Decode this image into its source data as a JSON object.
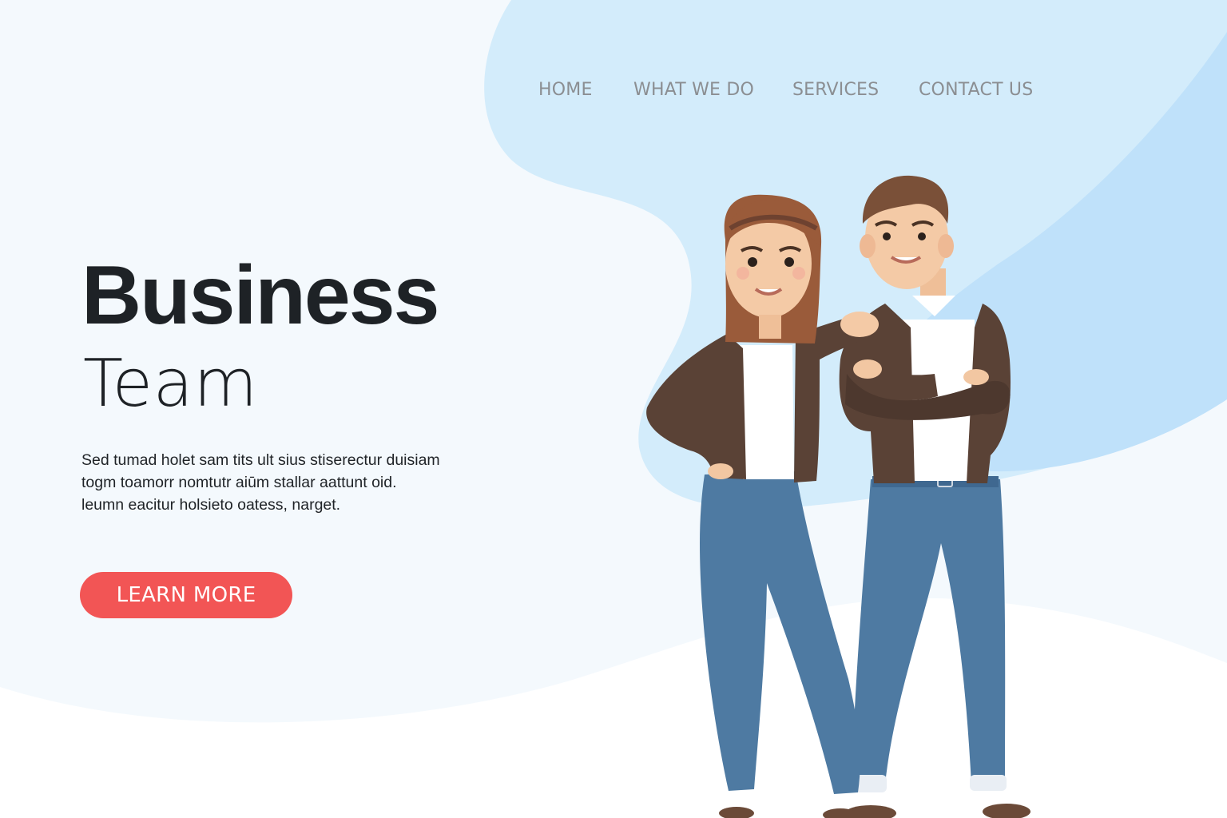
{
  "nav": {
    "items": [
      {
        "label": "HOME"
      },
      {
        "label": "WHAT WE DO"
      },
      {
        "label": "SERVICES"
      },
      {
        "label": "CONTACT US"
      }
    ]
  },
  "hero": {
    "title_line1": "Business",
    "title_line2": "Team",
    "description": [
      "Sed tumad holet sam tits ult sius stiserectur duisiam",
      "togm toamorr nomtutr aiūm stallar aattunt oid.",
      "leumn eacitur holsieto oatess, narget."
    ],
    "cta_label": "LEARN MORE"
  },
  "colors": {
    "accent": "#f25555",
    "blob_light": "#d3ecfb",
    "blob_mid": "#bfe1fa",
    "title": "#1e2226",
    "nav_text": "#8b8e92"
  },
  "icons": {
    "illustration": "business-team-illustration"
  }
}
